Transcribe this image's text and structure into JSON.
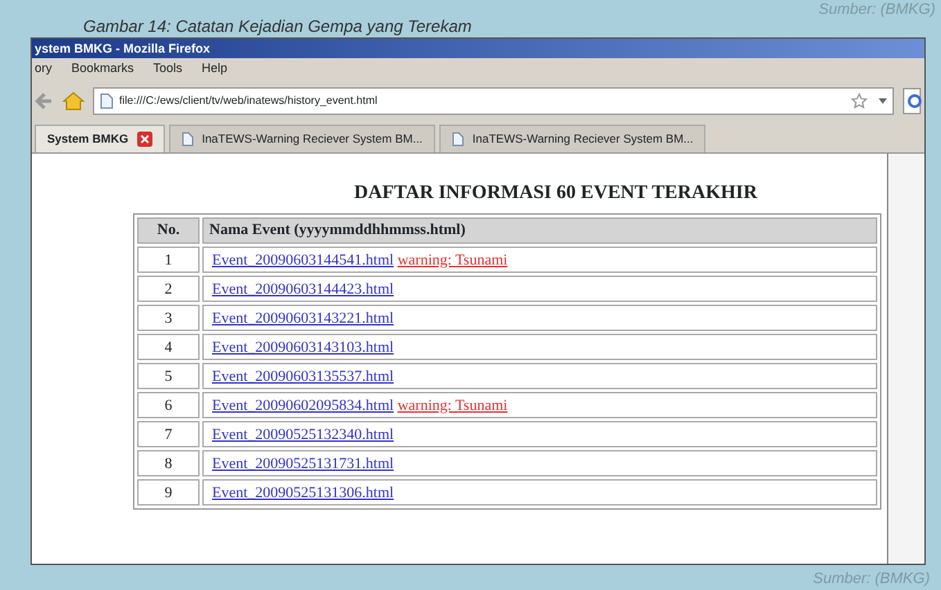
{
  "figure": {
    "caption": "Gambar 14: Catatan Kejadian Gempa yang Terekam",
    "source_top": "Sumber: (BMKG)",
    "source_bottom": "Sumber: (BMKG)"
  },
  "window": {
    "title": "ystem BMKG - Mozilla Firefox"
  },
  "menu": [
    "ory",
    "Bookmarks",
    "Tools",
    "Help"
  ],
  "address_bar": {
    "url": "file:///C:/ews/client/tv/web/inatews/history_event.html"
  },
  "tabs": [
    {
      "label": "System BMKG",
      "selected": true
    },
    {
      "label": "InaTEWS-Warning Reciever System BM...",
      "selected": false
    },
    {
      "label": "InaTEWS-Warning Reciever System BM...",
      "selected": false
    }
  ],
  "page": {
    "heading": "DAFTAR INFORMASI 60 EVENT TERAKHIR",
    "table": {
      "columns": [
        "No.",
        "Nama Event (yyyymmddhhmmss.html)"
      ],
      "rows": [
        {
          "no": "1",
          "event": "Event_20090603144541.html",
          "warning": "warning: Tsunami"
        },
        {
          "no": "2",
          "event": "Event_20090603144423.html"
        },
        {
          "no": "3",
          "event": "Event_20090603143221.html"
        },
        {
          "no": "4",
          "event": "Event_20090603143103.html"
        },
        {
          "no": "5",
          "event": "Event_20090603135537.html"
        },
        {
          "no": "6",
          "event": "Event_20090602095834.html",
          "warning": "warning: Tsunami"
        },
        {
          "no": "7",
          "event": "Event_20090525132340.html"
        },
        {
          "no": "8",
          "event": "Event_20090525131731.html"
        },
        {
          "no": "9",
          "event": "Event_20090525131306.html"
        }
      ]
    }
  }
}
